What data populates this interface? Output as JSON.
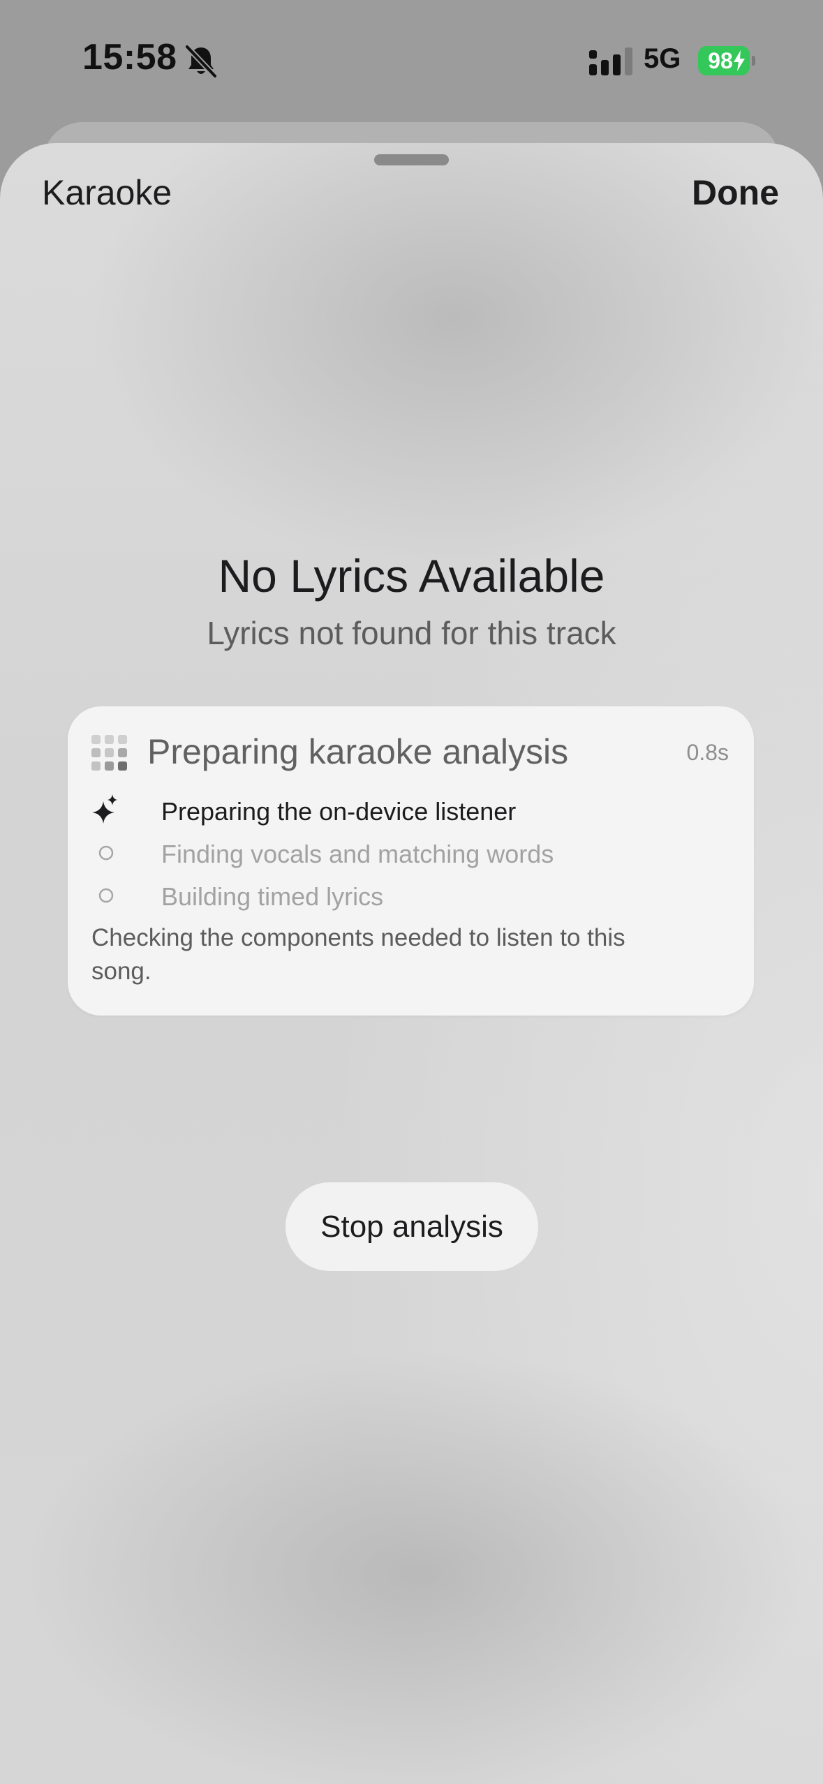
{
  "status_bar": {
    "time": "15:58",
    "network": "5G",
    "battery": "98",
    "icons": {
      "silent": "bell-slash-icon",
      "signal": "cellular-signal-icon",
      "charging": "bolt-icon"
    },
    "colors": {
      "battery": "#34c759"
    }
  },
  "sheet": {
    "title": "Karaoke",
    "done_label": "Done"
  },
  "empty_state": {
    "title": "No Lyrics Available",
    "subtitle": "Lyrics not found for this track"
  },
  "analysis": {
    "title": "Preparing karaoke analysis",
    "elapsed": "0.8s",
    "icon": "grid-dots-icon",
    "steps": [
      {
        "label": "Preparing the on-device listener",
        "state": "active",
        "icon": "sparkles-icon"
      },
      {
        "label": "Finding vocals and matching words",
        "state": "pending",
        "icon": "circle-icon"
      },
      {
        "label": "Building timed lyrics",
        "state": "pending",
        "icon": "circle-icon"
      }
    ],
    "description": "Checking the components needed to listen to this song."
  },
  "actions": {
    "stop_label": "Stop analysis"
  }
}
